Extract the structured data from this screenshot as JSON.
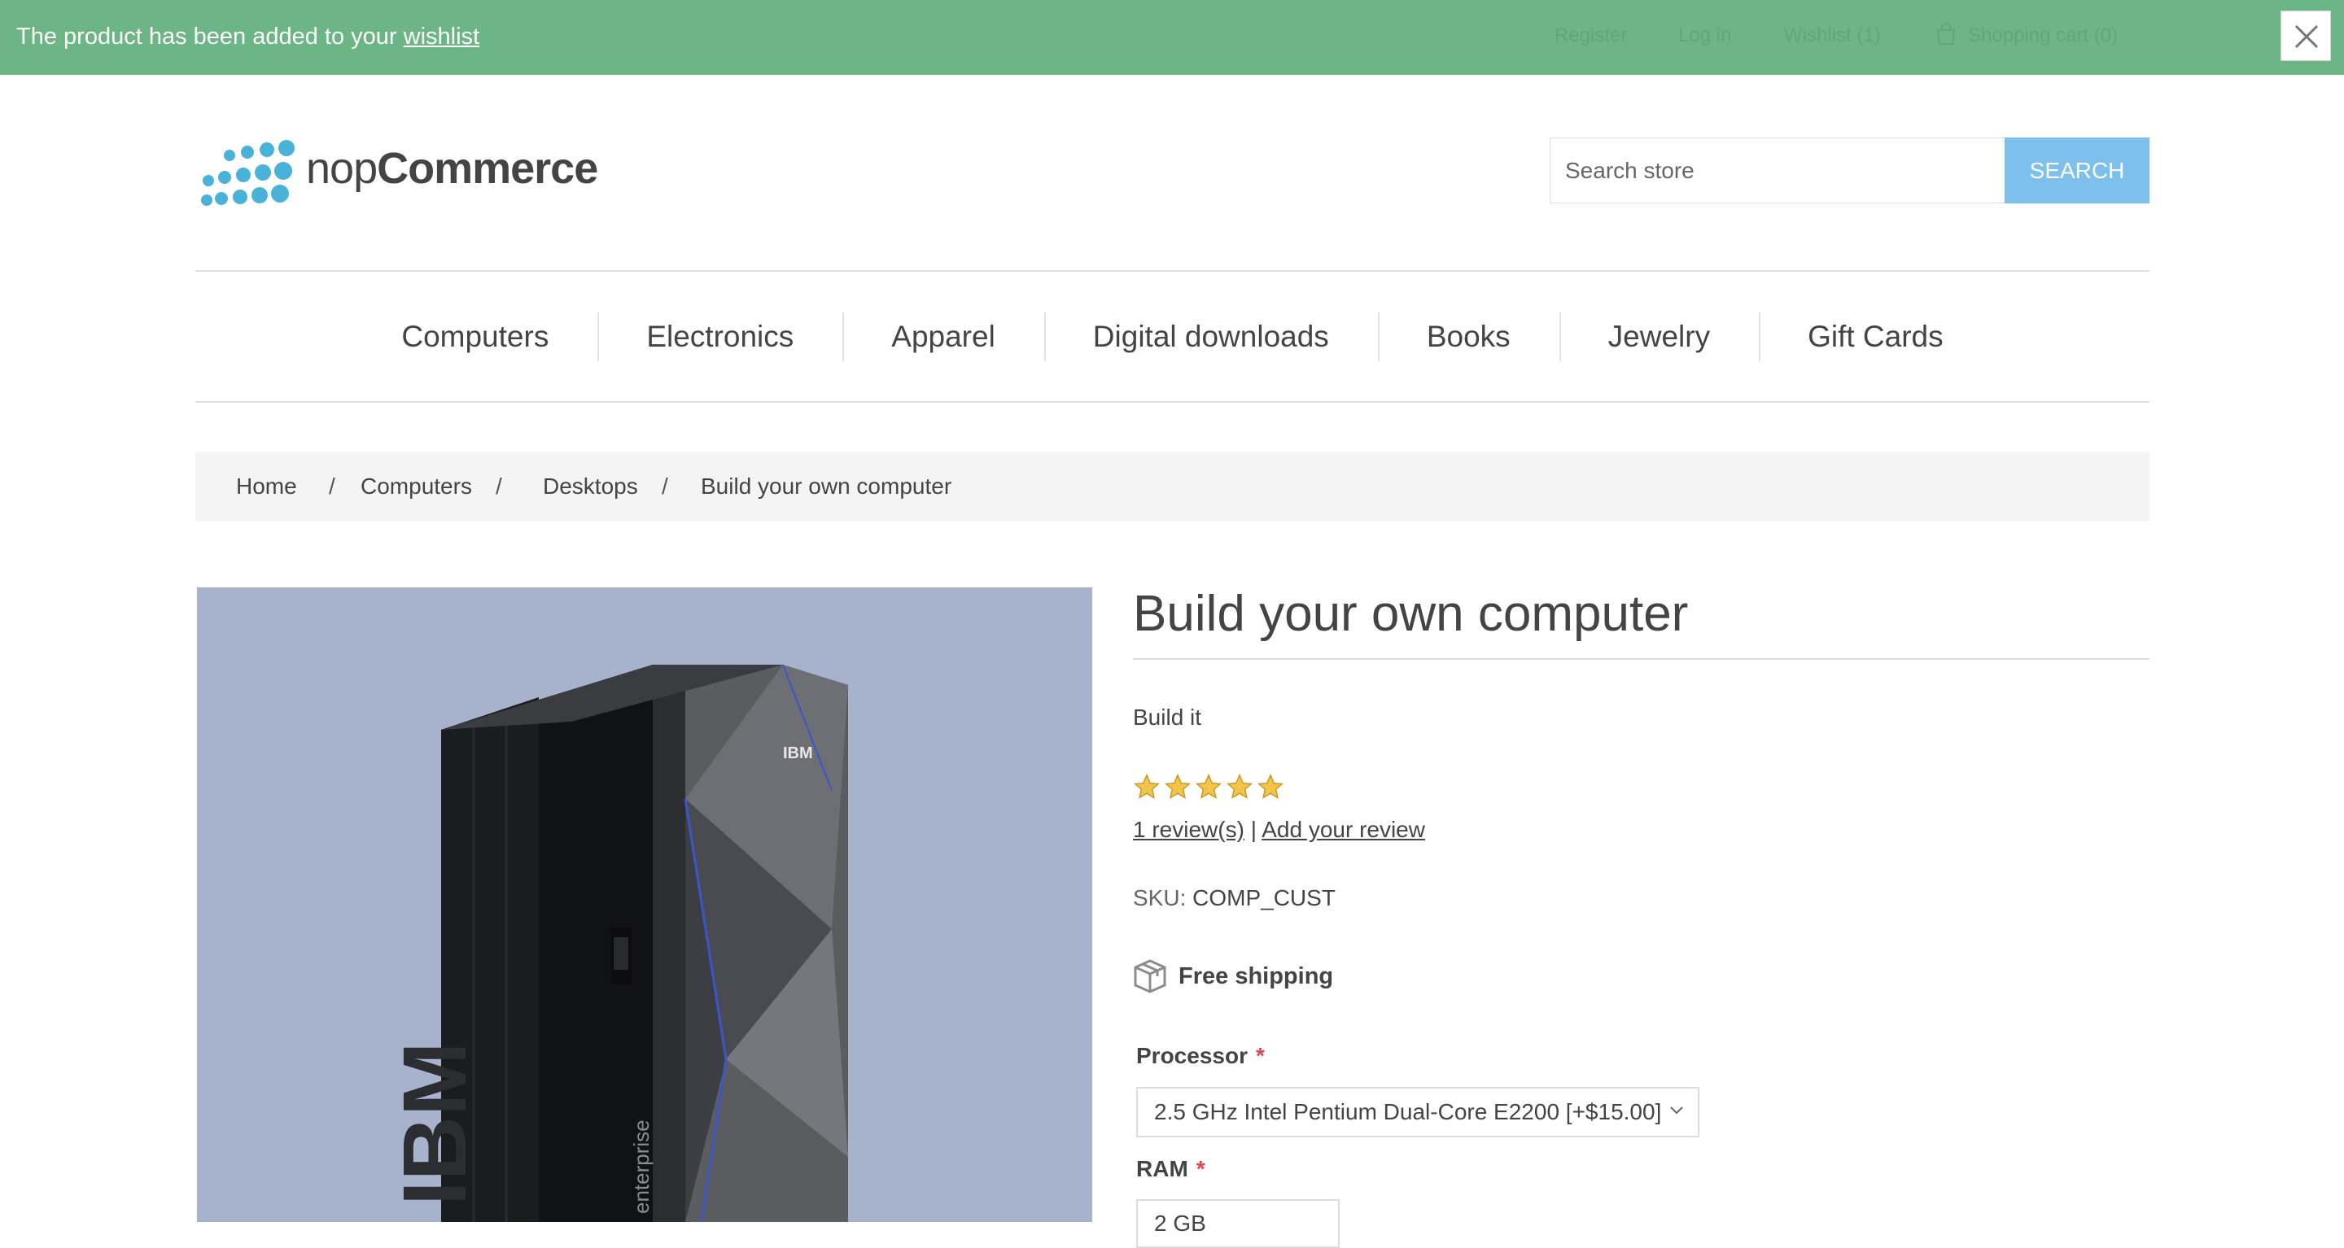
{
  "notification": {
    "message": "The product has been added to your ",
    "link": "wishlist",
    "header_links": [
      "Register",
      "Log in",
      "Wishlist (1)",
      "Shopping cart (0)"
    ]
  },
  "header": {
    "logo_text_light": "nop",
    "logo_text_bold": "Commerce",
    "search_placeholder": "Search store",
    "search_button": "SEARCH"
  },
  "menu": [
    "Computers",
    "Electronics",
    "Apparel",
    "Digital downloads",
    "Books",
    "Jewelry",
    "Gift Cards"
  ],
  "breadcrumb": {
    "items": [
      "Home",
      "Computers",
      "Desktops",
      "Build your own computer"
    ],
    "separator": "/"
  },
  "product": {
    "title": "Build your own computer",
    "short_description": "Build it",
    "rating_stars": 5,
    "reviews_link": "1 review(s)",
    "reviews_separator": "|",
    "add_review_link": "Add your review",
    "sku_label": "SKU:",
    "sku_value": "COMP_CUST",
    "shipping": "Free shipping",
    "image_brand_text": "IBM",
    "image_model_text": "enterprise"
  },
  "attributes": {
    "processor_label": "Processor",
    "processor_value": "2.5 GHz Intel Pentium Dual-Core E2200 [+$15.00]",
    "ram_label": "RAM",
    "ram_value": "2 GB",
    "required_marker": "*"
  },
  "colors": {
    "notification_bg": "#6cb584",
    "search_button_bg": "#67b6ec",
    "required": "#e4444c",
    "star": "#f3c44a",
    "product_image_bg": "#a7b3cc"
  }
}
